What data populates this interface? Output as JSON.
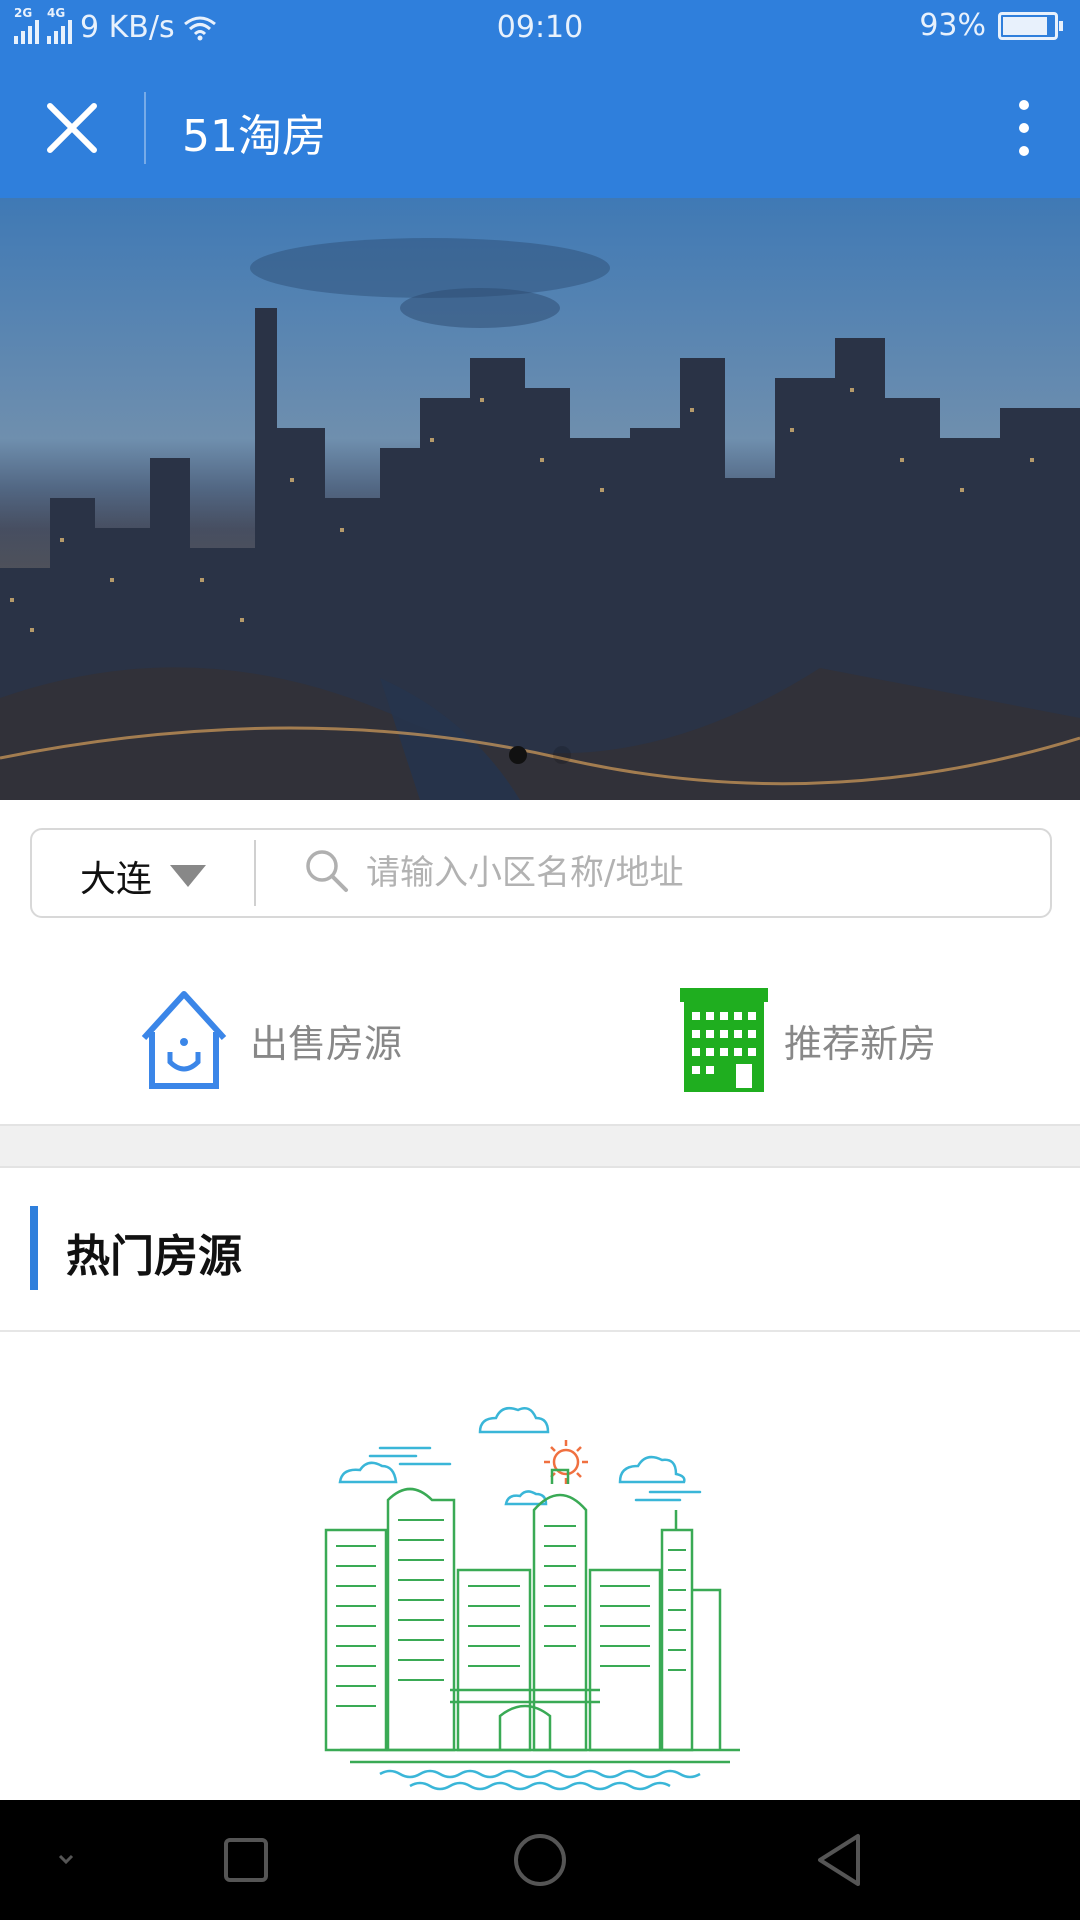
{
  "status_bar": {
    "signal1_label": "2G",
    "signal2_label": "4G",
    "speed": "9 KB/s",
    "time": "09:10",
    "battery": "93%"
  },
  "app_bar": {
    "title": "51淘房"
  },
  "banner": {
    "slide_count": 2,
    "active_slide": 0
  },
  "search": {
    "city": "大连",
    "placeholder": "请输入小区名称/地址"
  },
  "quick_links": [
    {
      "label": "出售房源",
      "icon": "house-icon",
      "color": "#3b86e8"
    },
    {
      "label": "推荐新房",
      "icon": "building-icon",
      "color": "#1fae1f"
    }
  ],
  "section": {
    "title": "热门房源"
  },
  "colors": {
    "primary": "#2f7fdc",
    "accent_green": "#1fae1f",
    "illustration_line": "#3aaa55",
    "sky_line": "#3ab6d8",
    "sun": "#f07040"
  }
}
